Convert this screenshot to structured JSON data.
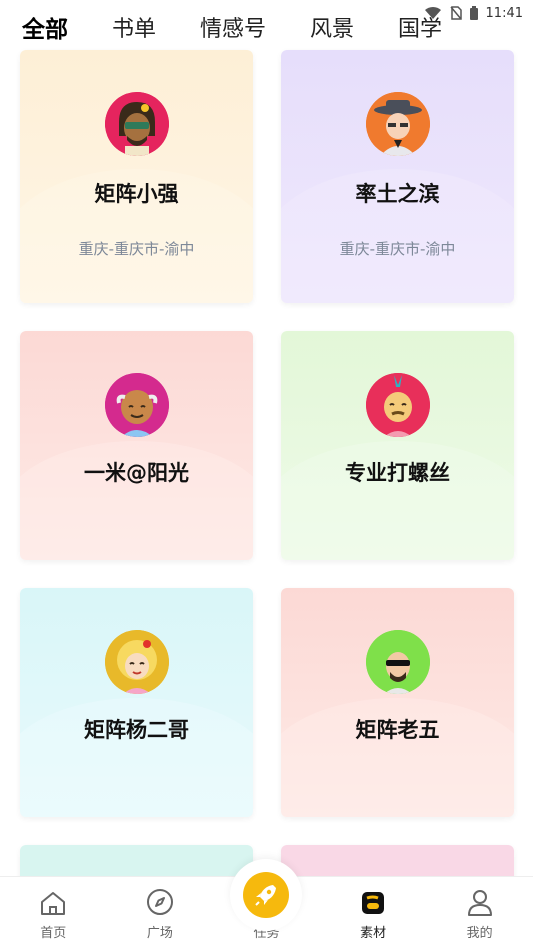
{
  "status": {
    "time": "11:41"
  },
  "tabs": [
    {
      "label": "全部"
    },
    {
      "label": "书单"
    },
    {
      "label": "情感号"
    },
    {
      "label": "风景"
    },
    {
      "label": "国学"
    }
  ],
  "cards": [
    {
      "name": "矩阵小强",
      "location": "重庆-重庆市-渝中",
      "bg": "#fdf0d8"
    },
    {
      "name": "率土之滨",
      "location": "重庆-重庆市-渝中",
      "bg": "#e8e1fb"
    },
    {
      "name": "一米@阳光",
      "location": "",
      "bg": "#fde2de"
    },
    {
      "name": "专业打螺丝",
      "location": "",
      "bg": "#e8f8e0"
    },
    {
      "name": "矩阵杨二哥",
      "location": "",
      "bg": "#def7f8"
    },
    {
      "name": "矩阵老五",
      "location": "",
      "bg": "#fde2de"
    }
  ],
  "nav": [
    {
      "label": "首页",
      "icon": "home-icon"
    },
    {
      "label": "广场",
      "icon": "compass-icon"
    },
    {
      "label": "任务",
      "icon": "rocket-icon"
    },
    {
      "label": "素材",
      "icon": "material-icon"
    },
    {
      "label": "我的",
      "icon": "user-icon"
    }
  ]
}
